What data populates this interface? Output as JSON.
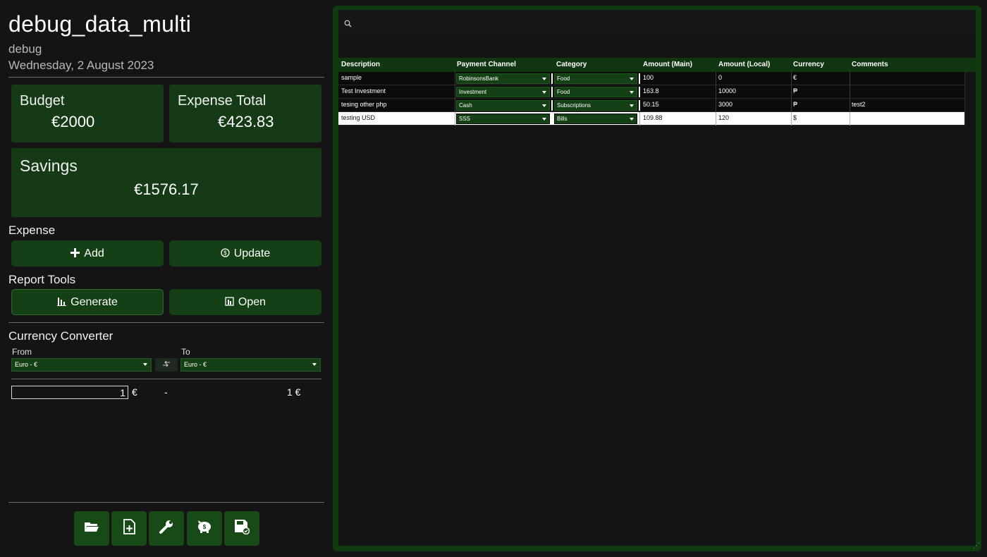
{
  "app": {
    "title": "debug_data_multi",
    "subtitle": "debug",
    "date": "Wednesday, 2 August 2023"
  },
  "summary": {
    "budget_label": "Budget",
    "budget_value": "€2000",
    "expense_total_label": "Expense Total",
    "expense_total_value": "€423.83",
    "savings_label": "Savings",
    "savings_value": "€1576.17"
  },
  "expense": {
    "section_label": "Expense",
    "add_label": "Add",
    "add_icon": "plus-icon",
    "update_label": "Update",
    "update_icon": "dollar-circle-icon"
  },
  "report": {
    "section_label": "Report Tools",
    "generate_label": "Generate",
    "generate_icon": "chart-icon",
    "open_label": "Open",
    "open_icon": "chart-icon"
  },
  "converter": {
    "section_label": "Currency Converter",
    "from_label": "From",
    "to_label": "To",
    "from_value": "Euro - €",
    "to_value": "Euro - €",
    "swap_icon": "swap-icon",
    "input_value": "1",
    "input_symbol": "€",
    "dash": "-",
    "result": "1 €"
  },
  "toolbar": {
    "icons": [
      "folder-open-icon",
      "new-file-icon",
      "wrench-icon",
      "piggy-bank-icon",
      "save-icon"
    ]
  },
  "search": {
    "icon": "search-icon",
    "placeholder": ""
  },
  "table": {
    "columns": [
      "Description",
      "Payment Channel",
      "Category",
      "Amount (Main)",
      "Amount (Local)",
      "Currency",
      "Comments"
    ],
    "rows": [
      {
        "description": "sample",
        "payment_channel": "RobinsonsBank",
        "category": "Food",
        "amount_main": "100",
        "amount_local": "0",
        "currency": "€",
        "comments": ""
      },
      {
        "description": "Test Investment",
        "payment_channel": "Investment",
        "category": "Food",
        "amount_main": "163.8",
        "amount_local": "10000",
        "currency": "₱",
        "comments": ""
      },
      {
        "description": "tesing other php",
        "payment_channel": "Cash",
        "category": "Subscriptions",
        "amount_main": "50.15",
        "amount_local": "3000",
        "currency": "₱",
        "comments": "test2"
      },
      {
        "description": "testing USD",
        "payment_channel": "SSS",
        "category": "Bills",
        "amount_main": "109.88",
        "amount_local": "120",
        "currency": "$",
        "comments": ""
      }
    ],
    "selected_row": 3
  },
  "colors": {
    "accent_green": "#153f15",
    "panel_border_green": "#0f3a10",
    "background": "#141414",
    "selected_row": "#ffffff"
  }
}
